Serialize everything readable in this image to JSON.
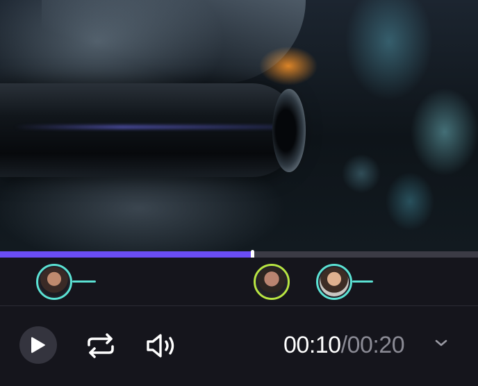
{
  "player": {
    "progress_fraction": 0.527,
    "current_time": "00:10",
    "separator": "/",
    "total_time": "00:20"
  },
  "markers": [
    {
      "name": "commenter-1",
      "ring_color": "#5be2d4",
      "active": false
    },
    {
      "name": "commenter-2",
      "ring_color": "#b8e542",
      "active": true
    },
    {
      "name": "commenter-3",
      "ring_color": "#5be2d4",
      "active": false
    }
  ],
  "controls": {
    "play_icon": "play-icon",
    "loop_icon": "repeat-icon",
    "volume_icon": "volume-icon",
    "time_menu_icon": "chevron-down-icon"
  },
  "colors": {
    "progress_fill": "#6a4df4",
    "progress_track": "#3b3b45",
    "marker_ring": "#5be2d4",
    "marker_ring_active": "#b8e542",
    "background": "#15151c"
  }
}
